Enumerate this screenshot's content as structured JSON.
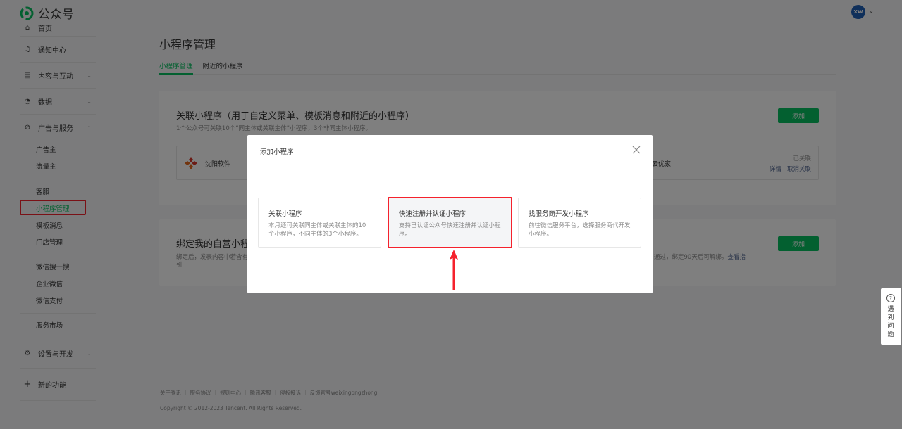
{
  "header": {
    "brand": "公众号",
    "avatar_text": "XW",
    "caret": "⌄"
  },
  "sidebar": {
    "home": "首页",
    "notifications": "通知中心",
    "content": "内容与互动",
    "data": "数据",
    "ads": "广告与服务",
    "ads_sub": [
      "广告主",
      "流量主"
    ],
    "service_sub": [
      "客服",
      "小程序管理",
      "模板消息",
      "门店管理"
    ],
    "wechat_sub": [
      "微信搜一搜",
      "企业微信",
      "微信支付"
    ],
    "market": "服务市场",
    "settings": "设置与开发",
    "new_features": "新的功能",
    "chev": "⌄",
    "plus": "+"
  },
  "main": {
    "title": "小程序管理",
    "tabs": [
      "小程序管理",
      "附近的小程序"
    ],
    "card1": {
      "title": "关联小程序（用于自定义菜单、模板消息和附近的小程序）",
      "desc": "1个公众号可关联10个“同主体或关联主体”小程序，3个非同主体小程序。",
      "add": "添加",
      "mini1_name": "沈阳软件",
      "mini2_name": "云优家",
      "status": "已关联",
      "details": "详情",
      "unlink": "取消关联"
    },
    "card2": {
      "title": "绑定我的自营小程序",
      "desc_left": "绑定后，发表内容中若含有",
      "desc_left2": "引",
      "desc_right": "通过，绑定90天后可解绑。",
      "guide": "查看指",
      "add": "添加"
    }
  },
  "dialog": {
    "title": "添加小程序",
    "options": [
      {
        "title": "关联小程序",
        "desc": "本月还可关联同主体或关联主体的10个小程序，不同主体的3个小程序。"
      },
      {
        "title": "快速注册并认证小程序",
        "desc": "支持已认证公众号快速注册并认证小程序。"
      },
      {
        "title": "找服务商开发小程序",
        "desc": "前往微信服务平台，选择服务商代开发小程序。"
      }
    ]
  },
  "help": {
    "icon": "?",
    "text": "遇到问题"
  },
  "footer": {
    "links": [
      "关于腾讯",
      "服务协议",
      "规则中心",
      "腾讯客服",
      "侵权投诉",
      "反馈官号weixingongzhong"
    ],
    "sep": "|",
    "copyright": "Copyright © 2012-2023 Tencent. All Rights Reserved."
  },
  "colors": {
    "accent": "#07c160",
    "highlight": "#f5222d",
    "link": "#576b95"
  }
}
